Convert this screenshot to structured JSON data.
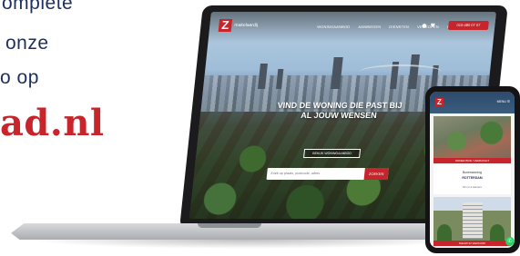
{
  "promo": {
    "line1": "omplete",
    "line2": "onze",
    "line3": "o op",
    "domain": "ad.nl"
  },
  "laptop_site": {
    "logo_mark": "Z",
    "logo_word": "makelaardij",
    "menu": [
      "WONINGAANBOD",
      "AANBIEDEN",
      "DIENSTEN",
      "VERKOPEN",
      "CONTACT"
    ],
    "call_label": "010-480 07 07",
    "hero_title": "VIND DE WONING DIE PAST BIJ AL JOUW WENSEN",
    "hero_button": "BEKIJK WONINGAANBOD",
    "search_placeholder": "Zoek op plaats, postcode, adres",
    "search_button": "ZOEKEN"
  },
  "phone_site": {
    "logo_mark": "Z",
    "menu_label": "MENU ☰",
    "badge1": "ONDER BOD / VERKOCHT",
    "listing_type": "Bovenwoning",
    "listing_city": "ROTTERDAM",
    "listing_meta": "60 m²    2 kamers",
    "badge2": "NIEUW IN VERKOOP"
  },
  "colors": {
    "brand_red": "#c8242b",
    "brand_navy": "#1d2f5f"
  }
}
